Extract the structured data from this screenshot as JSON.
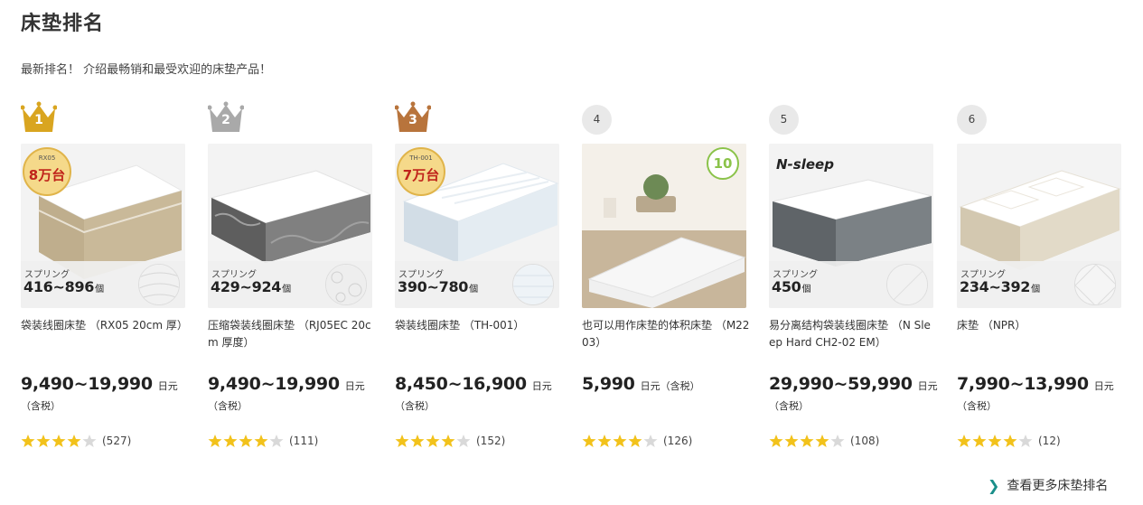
{
  "header": {
    "title": "床垫排名",
    "subtitle": "最新排名！ 介绍最畅销和最受欢迎的床垫产品！"
  },
  "colors": {
    "gold": "#d9a520",
    "silver": "#a9a9a9",
    "bronze": "#b8743c",
    "star_filled": "#f2c21b",
    "star_empty": "#d9d9d9",
    "accent": "#1a8f8a"
  },
  "products": [
    {
      "rank": "1",
      "rank_style": "gold-crown",
      "spec_label": "スプリング",
      "spec_value": "416~896",
      "spec_unit": "個",
      "badge_text": "8万台",
      "name": "袋装线圈床垫 （RX05 20cm 厚）",
      "price": "9,490~19,990",
      "price_unit": "日元（含税）",
      "stars": 4,
      "reviews": "(527)"
    },
    {
      "rank": "2",
      "rank_style": "silver-crown",
      "spec_label": "スプリング",
      "spec_value": "429~924",
      "spec_unit": "個",
      "name": "压缩袋装线圈床垫 （RJ05EC 20cm 厚度）",
      "price": "9,490~19,990",
      "price_unit": "日元（含税）",
      "stars": 4,
      "reviews": "(111)"
    },
    {
      "rank": "3",
      "rank_style": "bronze-crown",
      "spec_label": "スプリング",
      "spec_value": "390~780",
      "spec_unit": "個",
      "badge_text": "7万台",
      "name": "袋装线圈床垫 （TH-001）",
      "price": "8,450~16,900",
      "price_unit": "日元（含税）",
      "stars": 4,
      "reviews": "(152)"
    },
    {
      "rank": "4",
      "rank_style": "circle",
      "badge_text": "10",
      "name": "也可以用作床垫的体积床垫 （M2203）",
      "price": "5,990",
      "price_unit": "日元（含税）",
      "stars": 4,
      "reviews": "(126)"
    },
    {
      "rank": "5",
      "rank_style": "circle",
      "spec_label": "スプリング",
      "spec_value": "450",
      "spec_unit": "個",
      "logo_text": "N-sleep",
      "name": "易分离结构袋装线圈床垫 （N Sleep Hard CH2-02 EM）",
      "price": "29,990~59,990",
      "price_unit": "日元（含税）",
      "stars": 4,
      "reviews": "(108)"
    },
    {
      "rank": "6",
      "rank_style": "circle",
      "spec_label": "スプリング",
      "spec_value": "234~392",
      "spec_unit": "個",
      "name": "床垫 （NPR）",
      "price": "7,990~13,990",
      "price_unit": "日元（含税）",
      "stars": 4,
      "reviews": "(12)"
    }
  ],
  "footer": {
    "more_link": "查看更多床垫排名"
  }
}
